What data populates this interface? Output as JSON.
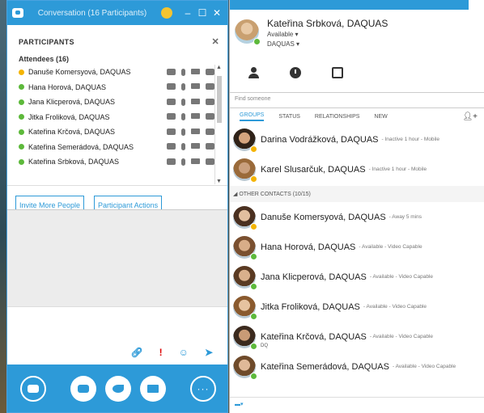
{
  "conversation": {
    "title": "Conversation (16 Participants)",
    "participants_header": "PARTICIPANTS",
    "attendees_label": "Attendees (16)",
    "participants": [
      {
        "name": "Danuše Komersyová, DAQUAS",
        "status": "away"
      },
      {
        "name": "Hana Horová, DAQUAS",
        "status": "available"
      },
      {
        "name": "Jana Klicperová, DAQUAS",
        "status": "available"
      },
      {
        "name": "Jitka Froliková, DAQUAS",
        "status": "available"
      },
      {
        "name": "Kateřina Krčová, DAQUAS",
        "status": "available"
      },
      {
        "name": "Kateřina Semerádová, DAQUAS",
        "status": "available"
      },
      {
        "name": "Kateřina Srbková, DAQUAS",
        "status": "available"
      }
    ],
    "invite_button": "Invite More People",
    "participant_actions_button": "Participant Actions"
  },
  "me": {
    "name": "Kateřina Srbková, DAQUAS",
    "status": "Available ▾",
    "location": "DAQUAS ▾"
  },
  "search": {
    "placeholder": "Find someone"
  },
  "filter_tabs": [
    "GROUPS",
    "STATUS",
    "RELATIONSHIPS",
    "NEW"
  ],
  "contacts_top": [
    {
      "name": "Darina Vodrážková, DAQUAS",
      "status": "- Inactive 1 hour - Mobile",
      "presence": "away"
    },
    {
      "name": "Karel Slusarčuk, DAQUAS",
      "status": "- Inactive 1 hour - Mobile",
      "presence": "away"
    }
  ],
  "group_header": "◢ OTHER CONTACTS (10/15)",
  "contacts_other": [
    {
      "name": "Danuše Komersyová, DAQUAS",
      "status": "- Away 5 mins",
      "presence": "away",
      "sub": ""
    },
    {
      "name": "Hana Horová, DAQUAS",
      "status": "- Available - Video Capable",
      "presence": "available",
      "sub": ""
    },
    {
      "name": "Jana Klicperová, DAQUAS",
      "status": "- Available - Video Capable",
      "presence": "available",
      "sub": ""
    },
    {
      "name": "Jitka Froliková, DAQUAS",
      "status": "- Available - Video Capable",
      "presence": "available",
      "sub": ""
    },
    {
      "name": "Kateřina Krčová, DAQUAS",
      "status": "- Available - Video Capable",
      "presence": "available",
      "sub": "DQ"
    },
    {
      "name": "Kateřina Semerádová, DAQUAS",
      "status": "- Available - Video Capable",
      "presence": "available",
      "sub": ""
    }
  ],
  "colors": {
    "accent": "#2d9ad8",
    "available": "#5db93b",
    "away": "#f4b400"
  }
}
